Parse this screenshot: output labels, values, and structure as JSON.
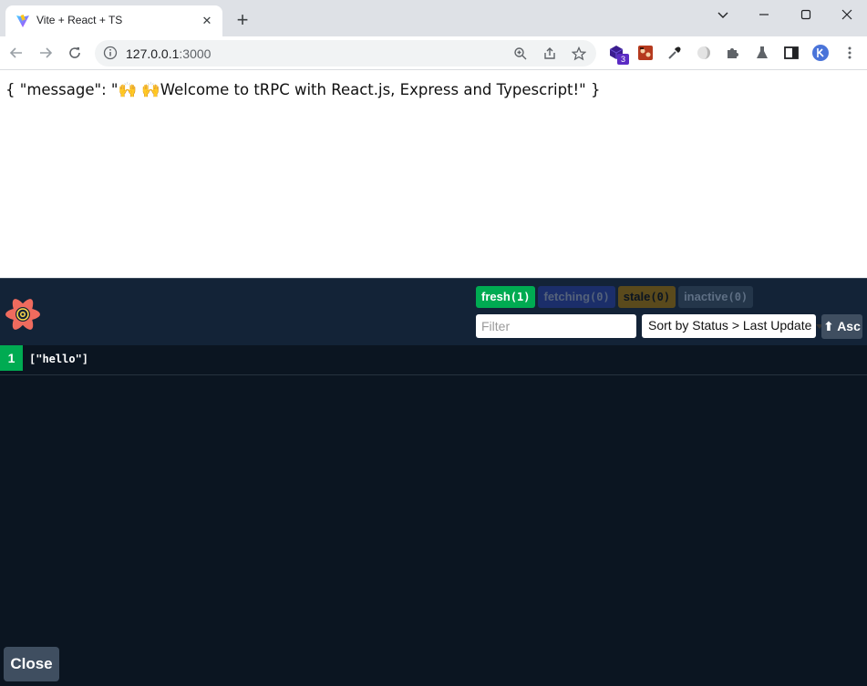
{
  "browser": {
    "tab": {
      "title": "Vite + React + TS",
      "close_icon": "close-icon",
      "favicon": "vite-logo"
    },
    "new_tab_label": "+",
    "url": {
      "host": "127.0.0.1",
      "port": ":3000"
    },
    "extensions": [
      "zoom-icon",
      "share-icon",
      "bookmark-star-icon",
      "cube-extension-icon",
      "game-extension-icon",
      "eyedropper-icon",
      "dark-reader-icon",
      "puzzle-icon",
      "flask-icon",
      "side-panel-icon",
      "profile-avatar",
      "menu-icon"
    ],
    "extension_badge": "3"
  },
  "page": {
    "message_text": "{ \"message\": \"🙌 🙌Welcome to tRPC with React.js, Express and Typescript!\" }"
  },
  "devtools": {
    "badges": [
      {
        "label": "fresh",
        "count": "(1)"
      },
      {
        "label": "fetching",
        "count": "(0)"
      },
      {
        "label": "stale",
        "count": "(0)"
      },
      {
        "label": "inactive",
        "count": "(0)"
      }
    ],
    "filter_placeholder": "Filter",
    "sort_label": "Sort by Status > Last Update",
    "order_label": "⬆ Asc",
    "queries": [
      {
        "observers": "1",
        "key": "[\"hello\"]"
      }
    ],
    "close_label": "Close",
    "colors": {
      "fresh": "#00ab52",
      "panel_bg": "#0b1521",
      "header_bg": "#132337"
    }
  }
}
